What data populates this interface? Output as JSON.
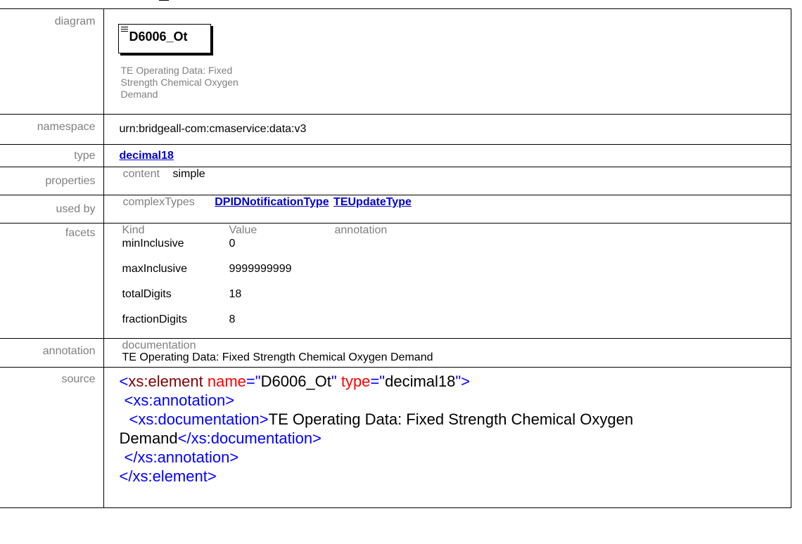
{
  "labels": {
    "diagram": "diagram",
    "namespace": "namespace",
    "type": "type",
    "properties": "properties",
    "used_by": "used by",
    "facets": "facets",
    "annotation": "annotation",
    "source": "source"
  },
  "diagram": {
    "element_name": "D6006_Ot",
    "documentation": "TE Operating Data: Fixed Strength Chemical Oxygen Demand"
  },
  "namespace": "urn:bridgeall-com:cmaservice:data:v3",
  "type": "decimal18",
  "properties": {
    "key": "content",
    "value": "simple"
  },
  "used_by": {
    "key": "complexTypes",
    "items": [
      "DPIDNotificationType",
      "TEUpdateType"
    ]
  },
  "facets": {
    "headers": [
      "Kind",
      "Value",
      "annotation"
    ],
    "rows": [
      {
        "kind": "minInclusive",
        "value": "0"
      },
      {
        "kind": "maxInclusive",
        "value": "9999999999"
      },
      {
        "kind": "totalDigits",
        "value": "18"
      },
      {
        "kind": "fractionDigits",
        "value": "8"
      }
    ]
  },
  "annotation": {
    "key": "documentation",
    "text": "TE Operating Data: Fixed Strength Chemical Oxygen Demand"
  },
  "source": {
    "l1_open": "<",
    "l1_tag": "xs:element",
    "l1_attr1": "name",
    "l1_eq": "=\"",
    "l1_val1": "D6006_Ot",
    "l1_q": "\"",
    "l1_attr2": "type",
    "l1_val2": "decimal18",
    "l1_end": "\">",
    "l2": "<xs:annotation>",
    "l3_tag": "<xs:documentation>",
    "l3_text": "TE Operating Data: Fixed Strength Chemical Oxygen",
    "l4_text": "Demand",
    "l4_close": "</xs:documentation>",
    "l5": "</xs:annotation>",
    "l6": "</xs:element>"
  }
}
